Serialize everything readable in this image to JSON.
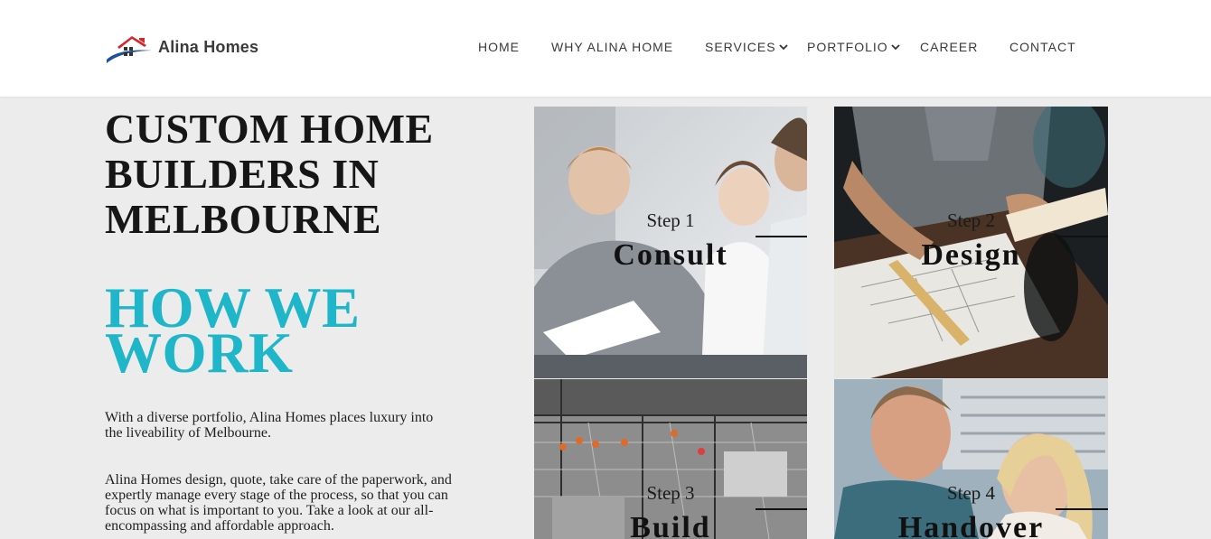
{
  "header": {
    "brand": "Alina Homes",
    "nav": [
      {
        "label": "HOME",
        "has_dropdown": false
      },
      {
        "label": "WHY ALINA HOME",
        "has_dropdown": false
      },
      {
        "label": "SERVICES",
        "has_dropdown": true
      },
      {
        "label": "PORTFOLIO",
        "has_dropdown": true
      },
      {
        "label": "CAREER",
        "has_dropdown": false
      },
      {
        "label": "CONTACT",
        "has_dropdown": false
      }
    ]
  },
  "hero": {
    "title": "CUSTOM HOME BUILDERS IN MELBOURNE",
    "subtitle": "HOW WE WORK",
    "paragraph_1": "With a diverse portfolio, Alina Homes places luxury into the liveability of Melbourne.",
    "paragraph_2": "Alina Homes design, quote, take care of the paperwork, and expertly manage every stage of the process, so that you can focus on what is important to you. Take a look at our all-encompassing and affordable approach."
  },
  "steps": [
    {
      "label": "Step 1",
      "name": "Consult",
      "image": "meeting-photo"
    },
    {
      "label": "Step 2",
      "name": "Design",
      "image": "blueprint-photo"
    },
    {
      "label": "Step 3",
      "name": "Build",
      "image": "construction-site-photo"
    },
    {
      "label": "Step 4",
      "name": "Handover",
      "image": "happy-couple-photo"
    }
  ],
  "colors": {
    "accent": "#1fb6c9",
    "logo_red": "#d9262b",
    "logo_blue": "#1f4e9c",
    "page_bg": "#ececec",
    "header_bg": "#ffffff"
  }
}
